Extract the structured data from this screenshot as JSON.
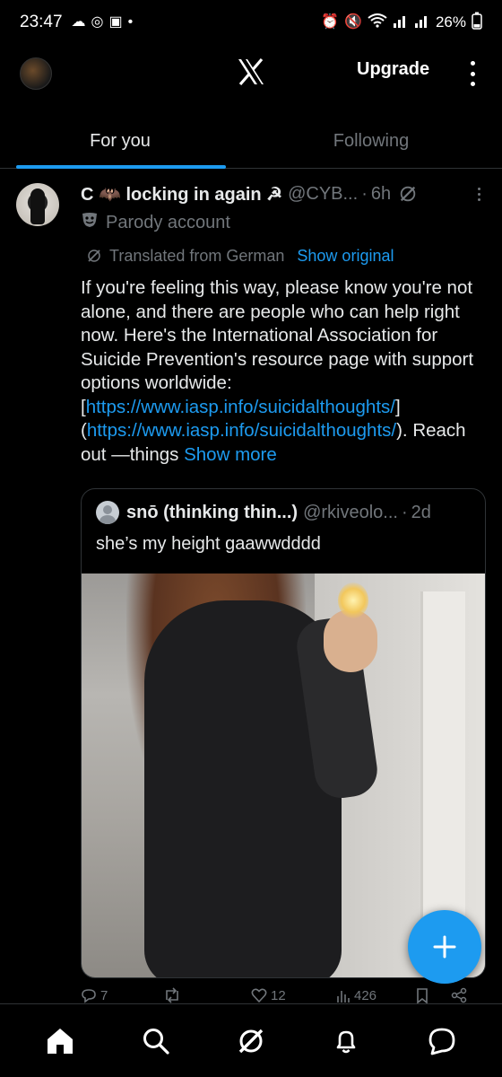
{
  "status_bar": {
    "time": "23:47",
    "battery": "26%",
    "left_icons": [
      "cloud-icon",
      "nfc-icon",
      "gallery-icon",
      "dot-icon"
    ],
    "right_icons": [
      "alarm-icon",
      "mute-icon",
      "wifi-icon",
      "signal-icon",
      "signal-icon"
    ]
  },
  "top_bar": {
    "upgrade_label": "Upgrade"
  },
  "tabs": [
    {
      "label": "For you",
      "active": true
    },
    {
      "label": "Following",
      "active": false
    }
  ],
  "post": {
    "display_name": "C 🦇 locking in again ☭",
    "handle": "@CYB...",
    "time": "6h",
    "parody_label": "Parody account",
    "translated_label": "Translated from German",
    "show_original_label": "Show original",
    "text_part1": "If you're feeling this way, please know you're not alone, and there are people who can help right now. Here's the International Association for Suicide Prevention's resource page with support options worldwide: [",
    "link1": "https://www.iasp.info/suicidalthoughts/",
    "text_part2": "](",
    "link2": "https://www.iasp.info/suicidalthoughts/",
    "text_part3": "). Reach out —things ",
    "show_more_label": "Show more"
  },
  "quote": {
    "display_name": "snō (thinking thin...)",
    "handle": "@rkiveolo...",
    "time": "2d",
    "text": "she’s my height gaawwdddd"
  },
  "actions": {
    "replies": "7",
    "reposts": "",
    "likes": "12",
    "views": "426"
  },
  "bottom_nav": [
    "home-icon",
    "search-icon",
    "grok-icon",
    "notifications-icon",
    "messages-icon"
  ],
  "colors": {
    "accent": "#1d9bf0",
    "background": "#000000",
    "muted": "#71767b",
    "text": "#e7e9ea"
  }
}
